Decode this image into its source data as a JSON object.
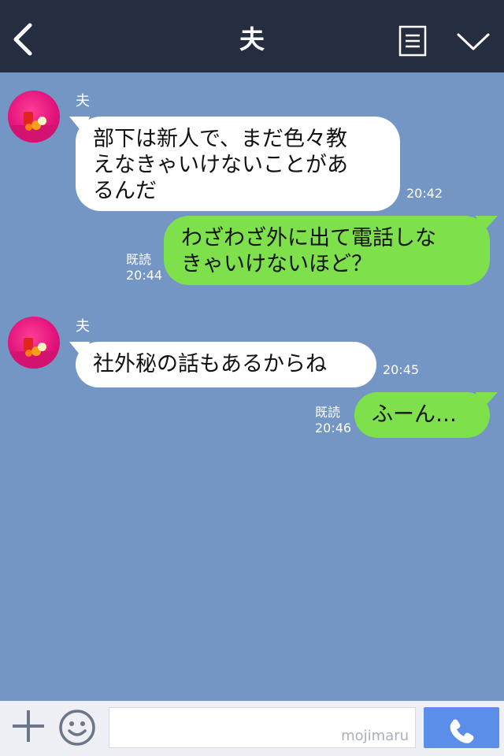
{
  "header": {
    "title": "夫"
  },
  "messages": [
    {
      "side": "left",
      "sender": "夫",
      "text": "部下は新人で、まだ色々教\nえなきゃいけないことがあ\nるんだ",
      "time": "20:42"
    },
    {
      "side": "right",
      "read": "既読",
      "text": "わざわざ外に出て電話しな\nきゃいけないほど？",
      "time": "20:44"
    },
    {
      "side": "left",
      "sender": "夫",
      "text": "社外秘の話もあるからね",
      "time": "20:45"
    },
    {
      "side": "right",
      "read": "既読",
      "text": "ふーん…",
      "time": "20:46"
    }
  ],
  "footer": {
    "input_placeholder": "",
    "watermark": "mojimaru"
  },
  "colors": {
    "header_bg": "#252d41",
    "chat_bg": "#7396c4",
    "incoming_bubble": "#ffffff",
    "outgoing_bubble": "#7ee04a",
    "call_button": "#5b8ee8"
  },
  "icons": {
    "back": "chevron-left-icon",
    "menu": "menu-list-icon",
    "collapse": "chevron-down-icon",
    "add": "plus-icon",
    "emoji": "smiley-icon",
    "call": "phone-icon"
  }
}
